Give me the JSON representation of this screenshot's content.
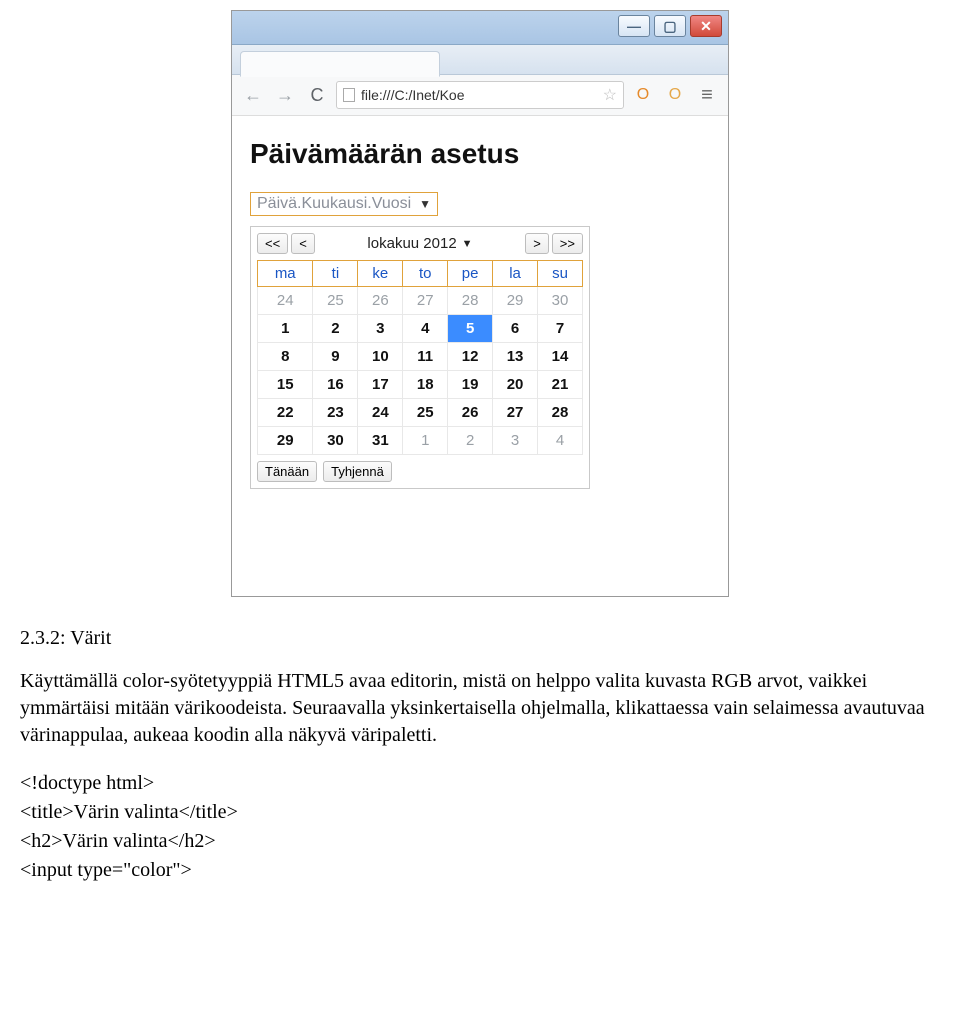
{
  "browser": {
    "url_text": "file:///C:/Inet/Koe",
    "nav": {
      "back": "←",
      "fwd": "→",
      "reload": "C"
    },
    "ext1": "O",
    "ext2": "O",
    "menu": "≡",
    "star": "☆",
    "win": {
      "min": "—",
      "max": "▢",
      "close": "✕"
    }
  },
  "page": {
    "h2": "Päivämäärän asetus",
    "date_placeholder": "Päivä.Kuukausi.Vuosi"
  },
  "picker": {
    "prev_year": "<<",
    "prev_month": "<",
    "month_label": "lokakuu 2012",
    "next_month": ">",
    "next_year": ">>",
    "dow": [
      "ma",
      "ti",
      "ke",
      "to",
      "pe",
      "la",
      "su"
    ],
    "weeks": [
      [
        {
          "d": "24",
          "o": true
        },
        {
          "d": "25",
          "o": true
        },
        {
          "d": "26",
          "o": true
        },
        {
          "d": "27",
          "o": true
        },
        {
          "d": "28",
          "o": true
        },
        {
          "d": "29",
          "o": true
        },
        {
          "d": "30",
          "o": true
        }
      ],
      [
        {
          "d": "1"
        },
        {
          "d": "2"
        },
        {
          "d": "3"
        },
        {
          "d": "4"
        },
        {
          "d": "5",
          "sel": true
        },
        {
          "d": "6"
        },
        {
          "d": "7"
        }
      ],
      [
        {
          "d": "8"
        },
        {
          "d": "9"
        },
        {
          "d": "10"
        },
        {
          "d": "11"
        },
        {
          "d": "12"
        },
        {
          "d": "13"
        },
        {
          "d": "14"
        }
      ],
      [
        {
          "d": "15"
        },
        {
          "d": "16"
        },
        {
          "d": "17"
        },
        {
          "d": "18"
        },
        {
          "d": "19"
        },
        {
          "d": "20"
        },
        {
          "d": "21"
        }
      ],
      [
        {
          "d": "22"
        },
        {
          "d": "23"
        },
        {
          "d": "24"
        },
        {
          "d": "25"
        },
        {
          "d": "26"
        },
        {
          "d": "27"
        },
        {
          "d": "28"
        }
      ],
      [
        {
          "d": "29"
        },
        {
          "d": "30"
        },
        {
          "d": "31"
        },
        {
          "d": "1",
          "o": true
        },
        {
          "d": "2",
          "o": true
        },
        {
          "d": "3",
          "o": true
        },
        {
          "d": "4",
          "o": true
        }
      ]
    ],
    "today": "Tänään",
    "clear": "Tyhjennä"
  },
  "doc": {
    "section": "2.3.2: Värit",
    "para": "Käyttämällä color-syötetyyppiä HTML5 avaa editorin, mistä on helppo valita kuvasta RGB arvot, vaikkei ymmärtäisi mitään värikoodeista. Seuraavalla yksinkertaisella ohjelmalla, klikattaessa vain selaimessa avautuvaa värinappulaa, aukeaa koodin alla näkyvä väripaletti.",
    "code": {
      "l1": "<!doctype html>",
      "l2": "<title>Värin valinta</title>",
      "l3": "<h2>Värin valinta</h2>",
      "l4": "<input type=\"color\">"
    }
  }
}
